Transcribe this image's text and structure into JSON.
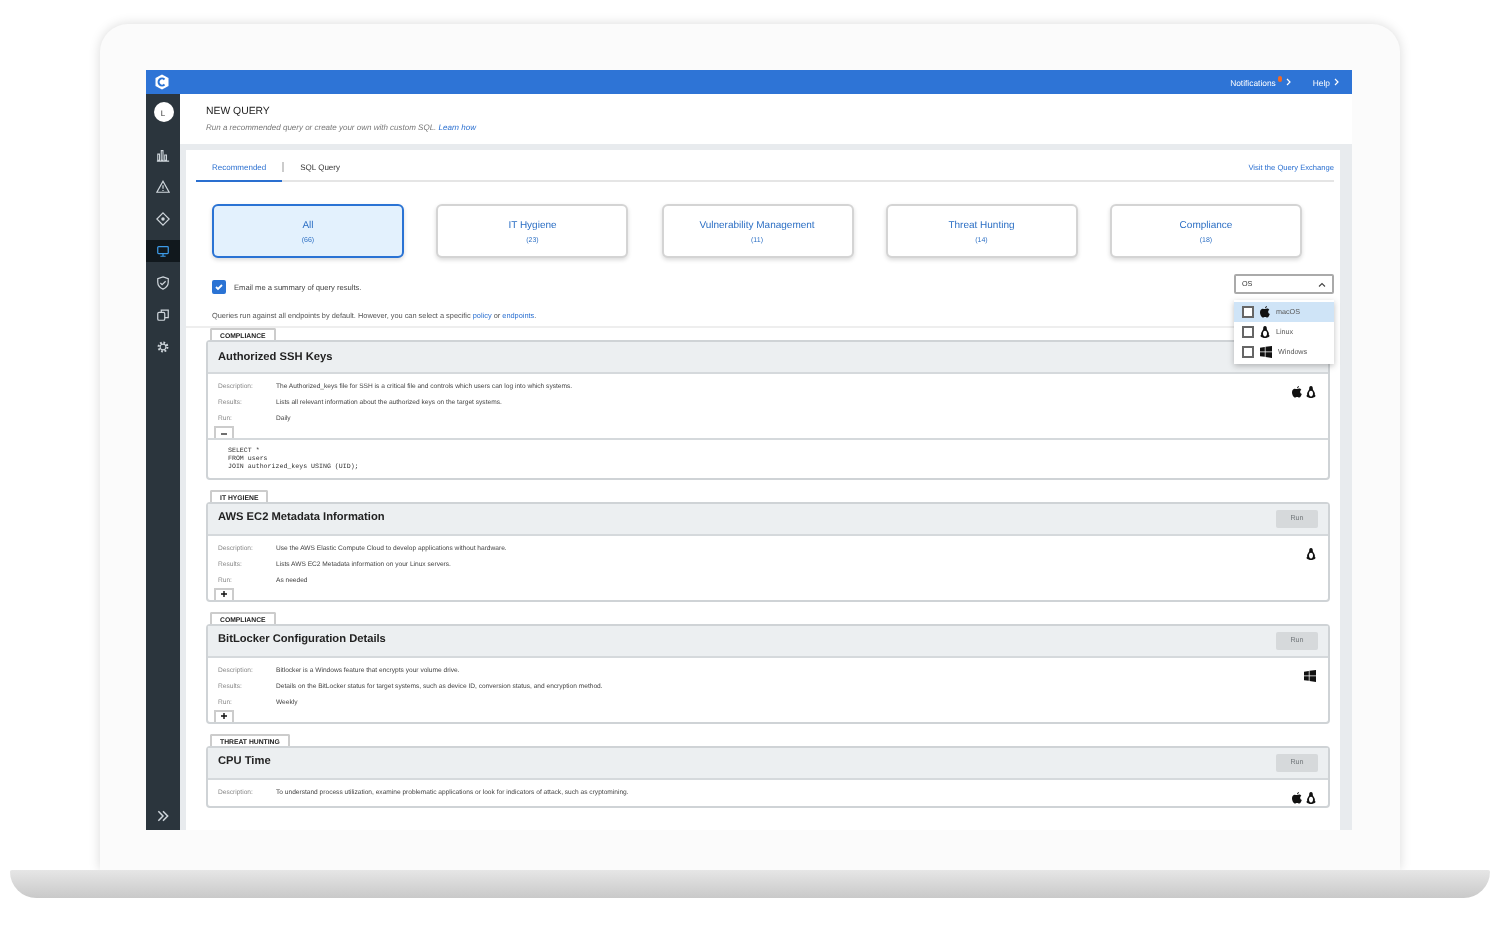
{
  "topbar": {
    "links": [
      {
        "label": "Notifications",
        "unread": true
      },
      {
        "label": "Help",
        "unread": false
      }
    ]
  },
  "sidebar": {
    "avatar_initial": "L",
    "items": [
      {
        "kind": "chart",
        "selected": false
      },
      {
        "kind": "warning",
        "selected": false
      },
      {
        "kind": "target",
        "selected": false
      },
      {
        "kind": "monitor",
        "selected": true
      },
      {
        "kind": "shield",
        "selected": false
      },
      {
        "kind": "copy",
        "selected": false
      },
      {
        "kind": "gear",
        "selected": false
      }
    ]
  },
  "header": {
    "title": "NEW QUERY",
    "subtitle": "Run a recommended query or create your own with custom SQL.",
    "link": "Learn how"
  },
  "tabs": [
    {
      "label": "Recommended",
      "selected": true
    },
    {
      "label": "SQL Query",
      "selected": false
    }
  ],
  "exchange_link": "Visit the Query Exchange",
  "categories": [
    {
      "label": "All",
      "count": "(66)",
      "selected": true
    },
    {
      "label": "IT Hygiene",
      "count": "(23)",
      "selected": false
    },
    {
      "label": "Vulnerability Management",
      "count": "(11)",
      "selected": false
    },
    {
      "label": "Threat Hunting",
      "count": "(14)",
      "selected": false
    },
    {
      "label": "Compliance",
      "count": "(18)",
      "selected": false
    }
  ],
  "email_option": {
    "label": "Email me a summary of query results.",
    "checked": true
  },
  "scope_note": [
    {
      "text": "Queries run against all endpoints by default. However, you can select a specific ",
      "kind": "text"
    },
    {
      "text": "policy",
      "kind": "link"
    },
    {
      "text": " or ",
      "kind": "text"
    },
    {
      "text": "endpoints",
      "kind": "link"
    },
    {
      "text": ".",
      "kind": "text"
    }
  ],
  "os_filter": {
    "label": "OS",
    "expanded": true,
    "options": [
      {
        "label": "macOS",
        "kind": "apple",
        "checked": false,
        "selected": true
      },
      {
        "label": "Linux",
        "kind": "linux",
        "checked": false,
        "selected": false
      },
      {
        "label": "Windows",
        "kind": "windows",
        "checked": false,
        "selected": false
      }
    ]
  },
  "queries": [
    {
      "category": "COMPLIANCE",
      "title": "Authorized SSH Keys",
      "expanded": true,
      "details": [
        {
          "label": "Description:",
          "value": "The Authorized_keys file for SSH is a critical file and controls which users can log into which systems."
        },
        {
          "label": "Results:",
          "value": "Lists all relevant information about the authorized keys on the target systems."
        },
        {
          "label": "Run:",
          "value": "Daily"
        }
      ],
      "platforms": [
        {
          "kind": "apple"
        },
        {
          "kind": "linux"
        }
      ],
      "sql": "SELECT *\nFROM users\nJOIN authorized_keys USING (UID);"
    },
    {
      "category": "IT HYGIENE",
      "title": "AWS EC2 Metadata Information",
      "expanded": false,
      "run": {
        "label": "Run",
        "disabled": true
      },
      "details": [
        {
          "label": "Description:",
          "value": "Use the AWS Elastic Compute Cloud to develop applications without hardware."
        },
        {
          "label": "Results:",
          "value": "Lists AWS EC2 Metadata information on your Linux servers."
        },
        {
          "label": "Run:",
          "value": "As needed"
        }
      ],
      "platforms": [
        {
          "kind": "linux"
        }
      ]
    },
    {
      "category": "COMPLIANCE",
      "title": "BitLocker Configuration Details",
      "expanded": false,
      "run": {
        "label": "Run",
        "disabled": true
      },
      "details": [
        {
          "label": "Description:",
          "value": "Bitlocker is a Windows feature that encrypts your volume drive."
        },
        {
          "label": "Results:",
          "value": "Details on the BitLocker status for target systems, such as device ID, conversion status, and encryption method."
        },
        {
          "label": "Run:",
          "value": "Weekly"
        }
      ],
      "platforms": [
        {
          "kind": "windows"
        }
      ]
    },
    {
      "category": "THREAT HUNTING",
      "title": "CPU Time",
      "run": {
        "label": "Run",
        "disabled": true
      },
      "details": [
        {
          "label": "Description:",
          "value": "To understand process utilization, examine problematic applications or look for indicators of attack, such as cryptomining."
        }
      ],
      "platforms": [
        {
          "kind": "apple"
        },
        {
          "kind": "linux"
        }
      ]
    }
  ]
}
